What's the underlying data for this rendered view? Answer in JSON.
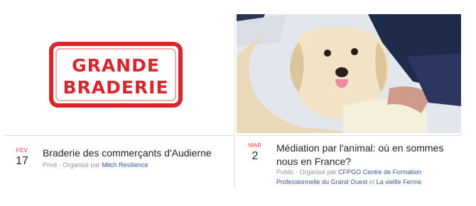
{
  "events": [
    {
      "image": {
        "kind": "stamp",
        "line1": "GRANDE",
        "line2": "BRADERIE",
        "color": "#d8262c"
      },
      "date": {
        "month": "FEV",
        "day": "17"
      },
      "title": "Braderie des commerçants d'Audierne",
      "meta": {
        "visibility": "Privé",
        "separator": " · ",
        "organized_by": "Organisé par",
        "organizer": "Mitch Resilience"
      }
    },
    {
      "image": {
        "kind": "photo",
        "subject": "dog-photo"
      },
      "date": {
        "month": "MAR",
        "day": "2"
      },
      "title": "Médiation par l'animal: où en sommes nous en France?",
      "meta": {
        "visibility": "Public",
        "separator": " · ",
        "organized_by": "Organisé par",
        "organizer1": "CFPGO Centre de Formation Professionnelle du Grand Ouest",
        "conjunction": "et",
        "organizer2": "La vieille Ferme"
      }
    }
  ],
  "colors": {
    "month": "#e0393e",
    "link": "#365899",
    "muted": "#90949c",
    "text": "#1d2129"
  }
}
